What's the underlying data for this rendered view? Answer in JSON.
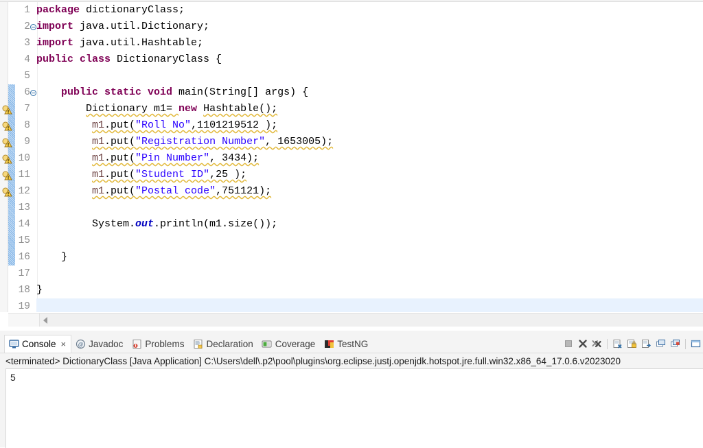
{
  "editor": {
    "font_note": "java source",
    "lines": [
      {
        "n": "1",
        "fold": false,
        "warn": false,
        "change": false,
        "current": false,
        "tokens": [
          {
            "t": "package ",
            "c": "kw"
          },
          {
            "t": "dictionaryClass;",
            "c": "plain"
          }
        ]
      },
      {
        "n": "2",
        "fold": true,
        "warn": false,
        "change": false,
        "current": false,
        "tokens": [
          {
            "t": "import ",
            "c": "kw"
          },
          {
            "t": "java.util.Dictionary;",
            "c": "plain"
          }
        ]
      },
      {
        "n": "3",
        "fold": false,
        "warn": false,
        "change": false,
        "current": false,
        "tokens": [
          {
            "t": "import ",
            "c": "kw"
          },
          {
            "t": "java.util.Hashtable;",
            "c": "plain"
          }
        ]
      },
      {
        "n": "4",
        "fold": false,
        "warn": false,
        "change": false,
        "current": false,
        "tokens": [
          {
            "t": "public class ",
            "c": "kw"
          },
          {
            "t": "DictionaryClass {",
            "c": "plain"
          }
        ]
      },
      {
        "n": "5",
        "fold": false,
        "warn": false,
        "change": false,
        "current": false,
        "tokens": []
      },
      {
        "n": "6",
        "fold": true,
        "warn": false,
        "change": true,
        "current": false,
        "tokens": [
          {
            "t": "    ",
            "c": "plain"
          },
          {
            "t": "public static void ",
            "c": "kw"
          },
          {
            "t": "main(String[] args) {",
            "c": "plain"
          }
        ]
      },
      {
        "n": "7",
        "fold": false,
        "warn": true,
        "change": true,
        "current": false,
        "tokens": [
          {
            "t": "        ",
            "c": "plain"
          },
          {
            "t": "Dictionary m1= ",
            "c": "plain warnund"
          },
          {
            "t": "new ",
            "c": "kw"
          },
          {
            "t": "Hashtable();",
            "c": "plain warnund"
          }
        ]
      },
      {
        "n": "8",
        "fold": false,
        "warn": true,
        "change": true,
        "current": false,
        "tokens": [
          {
            "t": "         ",
            "c": "plain"
          },
          {
            "t": "m1",
            "c": "fld warnund"
          },
          {
            "t": ".put(",
            "c": "plain warnund"
          },
          {
            "t": "\"Roll No\"",
            "c": "str warnund"
          },
          {
            "t": ",1101219512 );",
            "c": "plain warnund"
          }
        ]
      },
      {
        "n": "9",
        "fold": false,
        "warn": true,
        "change": true,
        "current": false,
        "tokens": [
          {
            "t": "         ",
            "c": "plain"
          },
          {
            "t": "m1",
            "c": "fld warnund"
          },
          {
            "t": ".put(",
            "c": "plain warnund"
          },
          {
            "t": "\"Registration Number\"",
            "c": "str warnund"
          },
          {
            "t": ", 1653005);",
            "c": "plain warnund"
          }
        ]
      },
      {
        "n": "10",
        "fold": false,
        "warn": true,
        "change": true,
        "current": false,
        "tokens": [
          {
            "t": "         ",
            "c": "plain"
          },
          {
            "t": "m1",
            "c": "fld warnund"
          },
          {
            "t": ".put(",
            "c": "plain warnund"
          },
          {
            "t": "\"Pin Number\"",
            "c": "str warnund"
          },
          {
            "t": ", 3434);",
            "c": "plain warnund"
          }
        ]
      },
      {
        "n": "11",
        "fold": false,
        "warn": true,
        "change": true,
        "current": false,
        "tokens": [
          {
            "t": "         ",
            "c": "plain"
          },
          {
            "t": "m1",
            "c": "fld warnund"
          },
          {
            "t": ".put(",
            "c": "plain warnund"
          },
          {
            "t": "\"Student ID\"",
            "c": "str warnund"
          },
          {
            "t": ",25 );",
            "c": "plain warnund"
          }
        ]
      },
      {
        "n": "12",
        "fold": false,
        "warn": true,
        "change": true,
        "current": false,
        "tokens": [
          {
            "t": "         ",
            "c": "plain"
          },
          {
            "t": "m1",
            "c": "fld warnund"
          },
          {
            "t": ".put(",
            "c": "plain warnund"
          },
          {
            "t": "\"Postal code\"",
            "c": "str warnund"
          },
          {
            "t": ",751121);",
            "c": "plain warnund"
          }
        ]
      },
      {
        "n": "13",
        "fold": false,
        "warn": false,
        "change": true,
        "current": false,
        "tokens": []
      },
      {
        "n": "14",
        "fold": false,
        "warn": false,
        "change": true,
        "current": false,
        "tokens": [
          {
            "t": "         System.",
            "c": "plain"
          },
          {
            "t": "out",
            "c": "statfld"
          },
          {
            "t": ".println(m1.size());",
            "c": "plain"
          }
        ]
      },
      {
        "n": "15",
        "fold": false,
        "warn": false,
        "change": true,
        "current": false,
        "tokens": []
      },
      {
        "n": "16",
        "fold": false,
        "warn": false,
        "change": true,
        "current": false,
        "tokens": [
          {
            "t": "    }",
            "c": "plain"
          }
        ]
      },
      {
        "n": "17",
        "fold": false,
        "warn": false,
        "change": false,
        "current": false,
        "tokens": []
      },
      {
        "n": "18",
        "fold": false,
        "warn": false,
        "change": false,
        "current": false,
        "tokens": [
          {
            "t": "}",
            "c": "plain"
          }
        ]
      },
      {
        "n": "19",
        "fold": false,
        "warn": false,
        "change": false,
        "current": true,
        "tokens": []
      }
    ]
  },
  "panel": {
    "tabs": [
      {
        "label": "Console",
        "icon": "console-icon",
        "active": true,
        "closable": true
      },
      {
        "label": "Javadoc",
        "icon": "javadoc-icon",
        "active": false,
        "closable": false
      },
      {
        "label": "Problems",
        "icon": "problems-icon",
        "active": false,
        "closable": false
      },
      {
        "label": "Declaration",
        "icon": "declaration-icon",
        "active": false,
        "closable": false
      },
      {
        "label": "Coverage",
        "icon": "coverage-icon",
        "active": false,
        "closable": false
      },
      {
        "label": "TestNG",
        "icon": "testng-icon",
        "active": false,
        "closable": false
      }
    ],
    "close_glyph": "×",
    "toolbar": [
      {
        "name": "terminate-button"
      },
      {
        "name": "remove-launch-button"
      },
      {
        "name": "remove-all-terminated-button"
      },
      {
        "name": "separator"
      },
      {
        "name": "clear-console-button"
      },
      {
        "name": "scroll-lock-button"
      },
      {
        "name": "word-wrap-button"
      },
      {
        "name": "pin-console-button"
      },
      {
        "name": "display-selected-console-button"
      },
      {
        "name": "separator"
      },
      {
        "name": "open-console-button"
      }
    ],
    "console_header": "<terminated> DictionaryClass [Java Application] C:\\Users\\dell\\.p2\\pool\\plugins\\org.eclipse.justj.openjdk.hotspot.jre.full.win32.x86_64_17.0.6.v2023020",
    "console_output": "5"
  },
  "colors": {
    "keyword": "#7f0055",
    "string": "#2a00ff",
    "field": "#6a3e3e",
    "static_field": "#0000c0",
    "current_line": "#e8f2fe",
    "warning_underline": "#e2b93b",
    "change_bar": "#a8cdee",
    "panel_bg": "#f4f4f4"
  }
}
